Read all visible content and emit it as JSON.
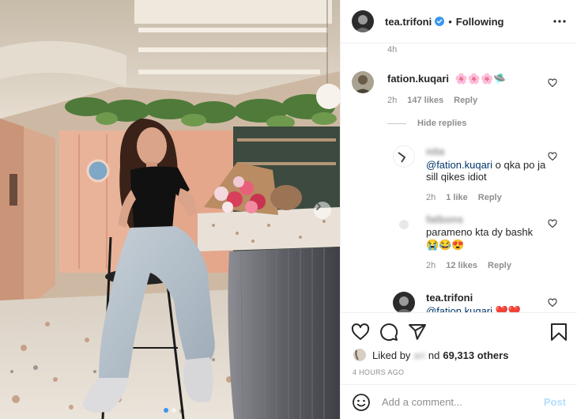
{
  "header": {
    "username": "tea.trifoni",
    "separator": "•",
    "follow_label": "Following"
  },
  "caption": {
    "time": "4h"
  },
  "comments": [
    {
      "username": "fation.kuqari",
      "text": "🌸🌸🌸🛸",
      "time": "2h",
      "likes": "147 likes",
      "reply_label": "Reply"
    }
  ],
  "hide_replies_label": "Hide replies",
  "replies": [
    {
      "username": "nita",
      "mention": "@fation.kuqari",
      "text": " o qka po ja sill qikes idiot",
      "time": "2h",
      "likes": "1 like",
      "reply_label": "Reply"
    },
    {
      "username": "fatbons",
      "mention": "",
      "text": "parameno kta dy bashk",
      "emojis": "😭😂😍",
      "time": "2h",
      "likes": "12 likes",
      "reply_label": "Reply"
    },
    {
      "username": "tea.trifoni",
      "mention": "@fation.kuqari",
      "text": " ❤️❤️"
    }
  ],
  "likes": {
    "prefix": "Liked by",
    "blurred": "ari",
    "connector": "nd",
    "count": "69,313 others"
  },
  "time_ago": "4 HOURS AGO",
  "comment_box": {
    "placeholder": "Add a comment...",
    "post_label": "Post"
  },
  "colors": {
    "verified": "#3897f0",
    "mention": "#00376b",
    "post_button": "#b2dffc",
    "meta_text": "#8e8e8e"
  },
  "icons": [
    "next-arrow-icon",
    "verified-icon",
    "more-options-icon",
    "heart-icon",
    "comment-icon",
    "share-icon",
    "bookmark-icon",
    "emoji-icon"
  ]
}
